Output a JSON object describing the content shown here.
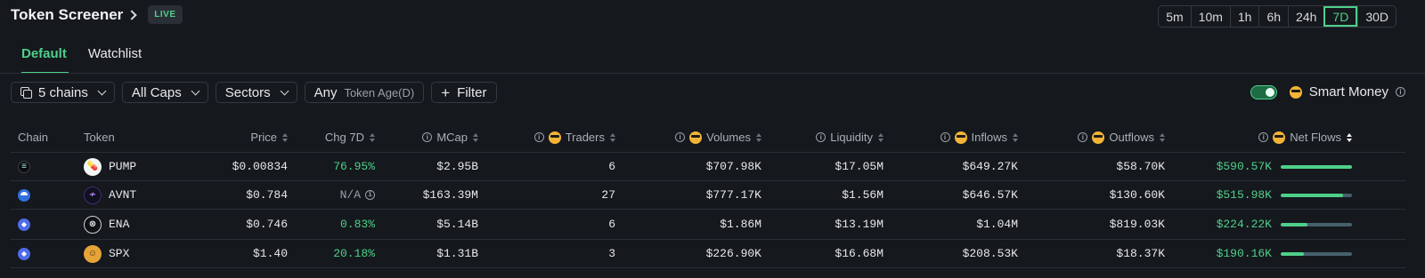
{
  "header": {
    "title": "Token Screener",
    "badge": "LIVE"
  },
  "timeframes": [
    {
      "label": "5m",
      "active": false
    },
    {
      "label": "10m",
      "active": false
    },
    {
      "label": "1h",
      "active": false
    },
    {
      "label": "6h",
      "active": false
    },
    {
      "label": "24h",
      "active": false
    },
    {
      "label": "7D",
      "active": true
    },
    {
      "label": "30D",
      "active": false
    }
  ],
  "tabs": [
    {
      "label": "Default",
      "active": true
    },
    {
      "label": "Watchlist",
      "active": false
    }
  ],
  "filters": {
    "chains": "5 chains",
    "caps": "All Caps",
    "sectors": "Sectors",
    "age_value": "Any",
    "age_label": "Token Age(D)",
    "filter": "Filter"
  },
  "smart_money": {
    "label": "Smart Money",
    "enabled": true
  },
  "columns": {
    "chain": "Chain",
    "token": "Token",
    "price": "Price",
    "chg": "Chg 7D",
    "mcap": "MCap",
    "traders": "Traders",
    "volumes": "Volumes",
    "liquidity": "Liquidity",
    "inflows": "Inflows",
    "outflows": "Outflows",
    "netflows": "Net Flows"
  },
  "accent_color": "#4ed08a",
  "rows": [
    {
      "chain": "solana",
      "token": "PUMP",
      "price": "$0.00834",
      "chg": "76.95%",
      "chg_color": "green",
      "mcap": "$2.95B",
      "traders": "6",
      "volumes": "$707.98K",
      "liquidity": "$17.05M",
      "inflows": "$649.27K",
      "outflows": "$58.70K",
      "netflows": "$590.57K",
      "net_ratio": 1.0
    },
    {
      "chain": "base",
      "token": "AVNT",
      "price": "$0.784",
      "chg": "N/A",
      "chg_color": "muted",
      "mcap": "$163.39M",
      "traders": "27",
      "volumes": "$777.17K",
      "liquidity": "$1.56M",
      "inflows": "$646.57K",
      "outflows": "$130.60K",
      "netflows": "$515.98K",
      "net_ratio": 0.87
    },
    {
      "chain": "ethereum",
      "token": "ENA",
      "price": "$0.746",
      "chg": "0.83%",
      "chg_color": "green",
      "mcap": "$5.14B",
      "traders": "6",
      "volumes": "$1.86M",
      "liquidity": "$13.19M",
      "inflows": "$1.04M",
      "outflows": "$819.03K",
      "netflows": "$224.22K",
      "net_ratio": 0.38
    },
    {
      "chain": "ethereum",
      "token": "SPX",
      "price": "$1.40",
      "chg": "20.18%",
      "chg_color": "green",
      "mcap": "$1.31B",
      "traders": "3",
      "volumes": "$226.90K",
      "liquidity": "$16.68M",
      "inflows": "$208.53K",
      "outflows": "$18.37K",
      "netflows": "$190.16K",
      "net_ratio": 0.32
    }
  ]
}
